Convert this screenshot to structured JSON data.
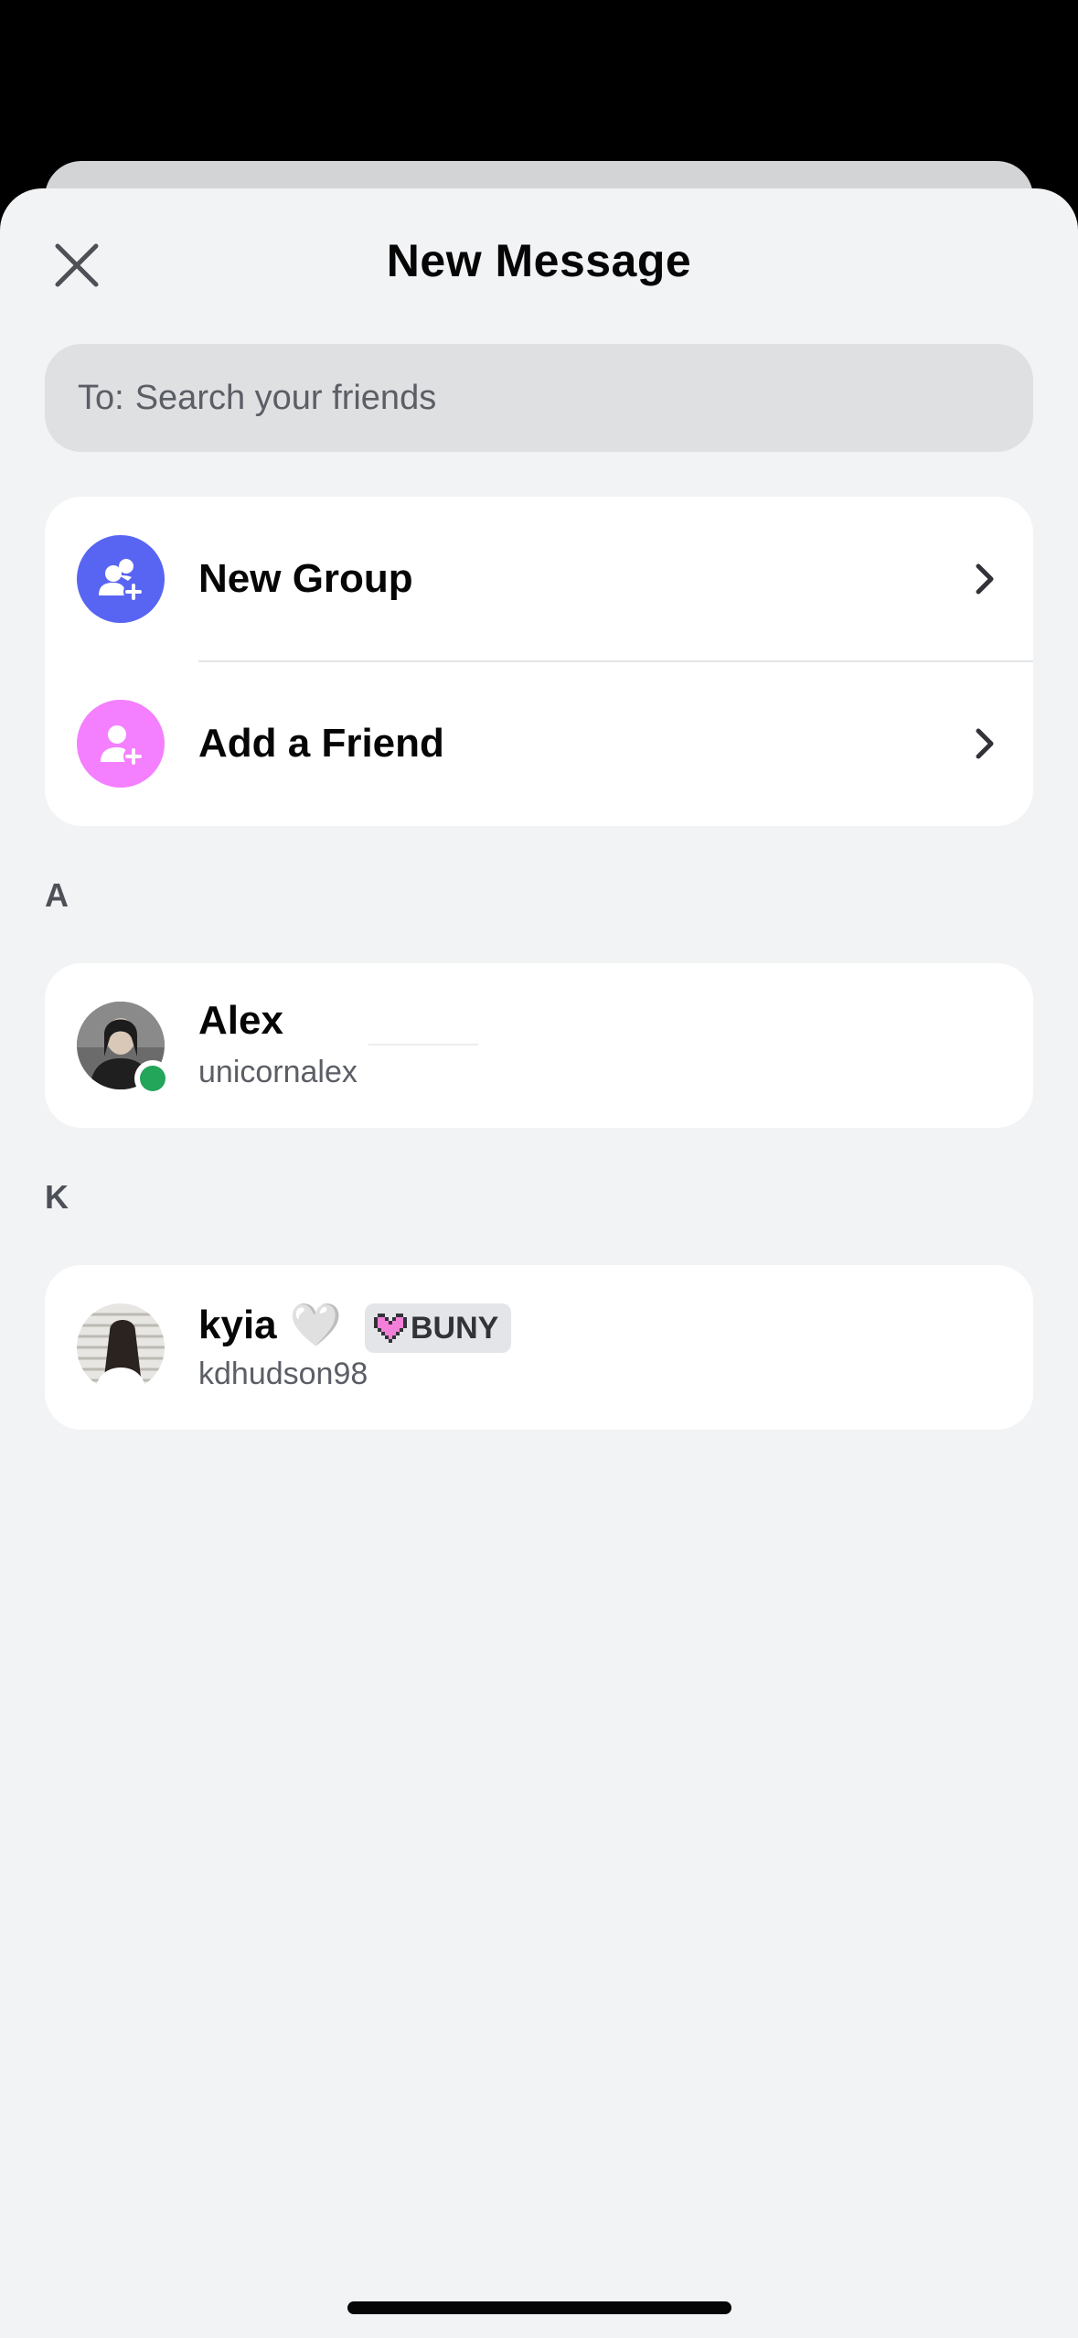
{
  "header": {
    "title": "New Message"
  },
  "search": {
    "prefix": "To:",
    "placeholder": "Search your friends"
  },
  "actions": [
    {
      "label": "New Group",
      "icon": "new-group-icon",
      "color": "#5865f2"
    },
    {
      "label": "Add a Friend",
      "icon": "add-friend-icon",
      "color": "#f47fff"
    }
  ],
  "sections": [
    {
      "letter": "A",
      "friends": [
        {
          "display_name": "Alex",
          "username": "unicornalex",
          "status": "online"
        }
      ]
    },
    {
      "letter": "K",
      "friends": [
        {
          "display_name": "kyia",
          "emoji": "🤍",
          "tag": "BUNY",
          "username": "kdhudson98"
        }
      ]
    }
  ],
  "colors": {
    "sheet_bg": "#f2f3f5",
    "card_bg": "#ffffff",
    "online": "#23a55a",
    "blurple": "#5865f2",
    "pink": "#f47fff"
  }
}
